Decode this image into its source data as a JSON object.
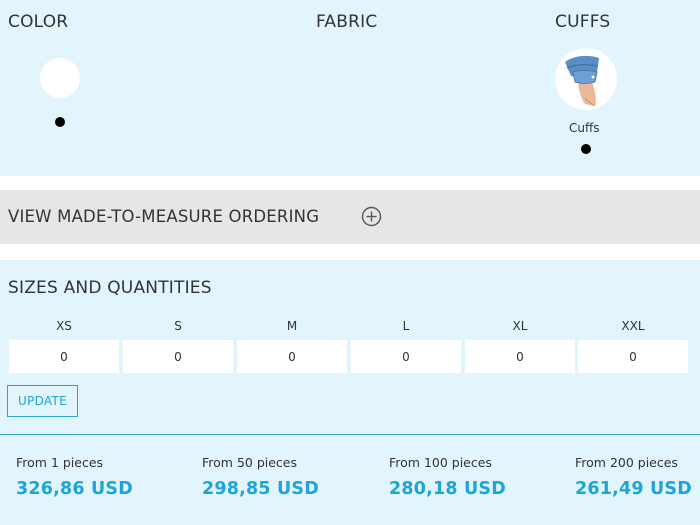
{
  "options": {
    "color": {
      "title": "COLOR"
    },
    "fabric": {
      "title": "FABRIC"
    },
    "cuffs": {
      "title": "CUFFS",
      "item_label": "Cuffs",
      "item_icon": "shirt-cuff-image"
    }
  },
  "made_to_measure": {
    "label": "VIEW MADE-TO-MEASURE ORDERING",
    "icon": "plus-circle-icon"
  },
  "sizes": {
    "title": "SIZES AND QUANTITIES",
    "items": [
      {
        "label": "XS",
        "value": "0"
      },
      {
        "label": "S",
        "value": "0"
      },
      {
        "label": "M",
        "value": "0"
      },
      {
        "label": "L",
        "value": "0"
      },
      {
        "label": "XL",
        "value": "0"
      },
      {
        "label": "XXL",
        "value": "0"
      }
    ],
    "update_label": "UPDATE"
  },
  "prices": [
    {
      "label": "From 1 pieces",
      "value": "326,86 USD"
    },
    {
      "label": "From 50 pieces",
      "value": "298,85 USD"
    },
    {
      "label": "From 100 pieces",
      "value": "280,18 USD"
    },
    {
      "label": "From 200 pieces",
      "value": "261,49 USD"
    }
  ],
  "colors": {
    "accent": "#1ea4d8",
    "panel_bg": "#e2f4fc",
    "mtm_bg": "#e4e6e7"
  }
}
